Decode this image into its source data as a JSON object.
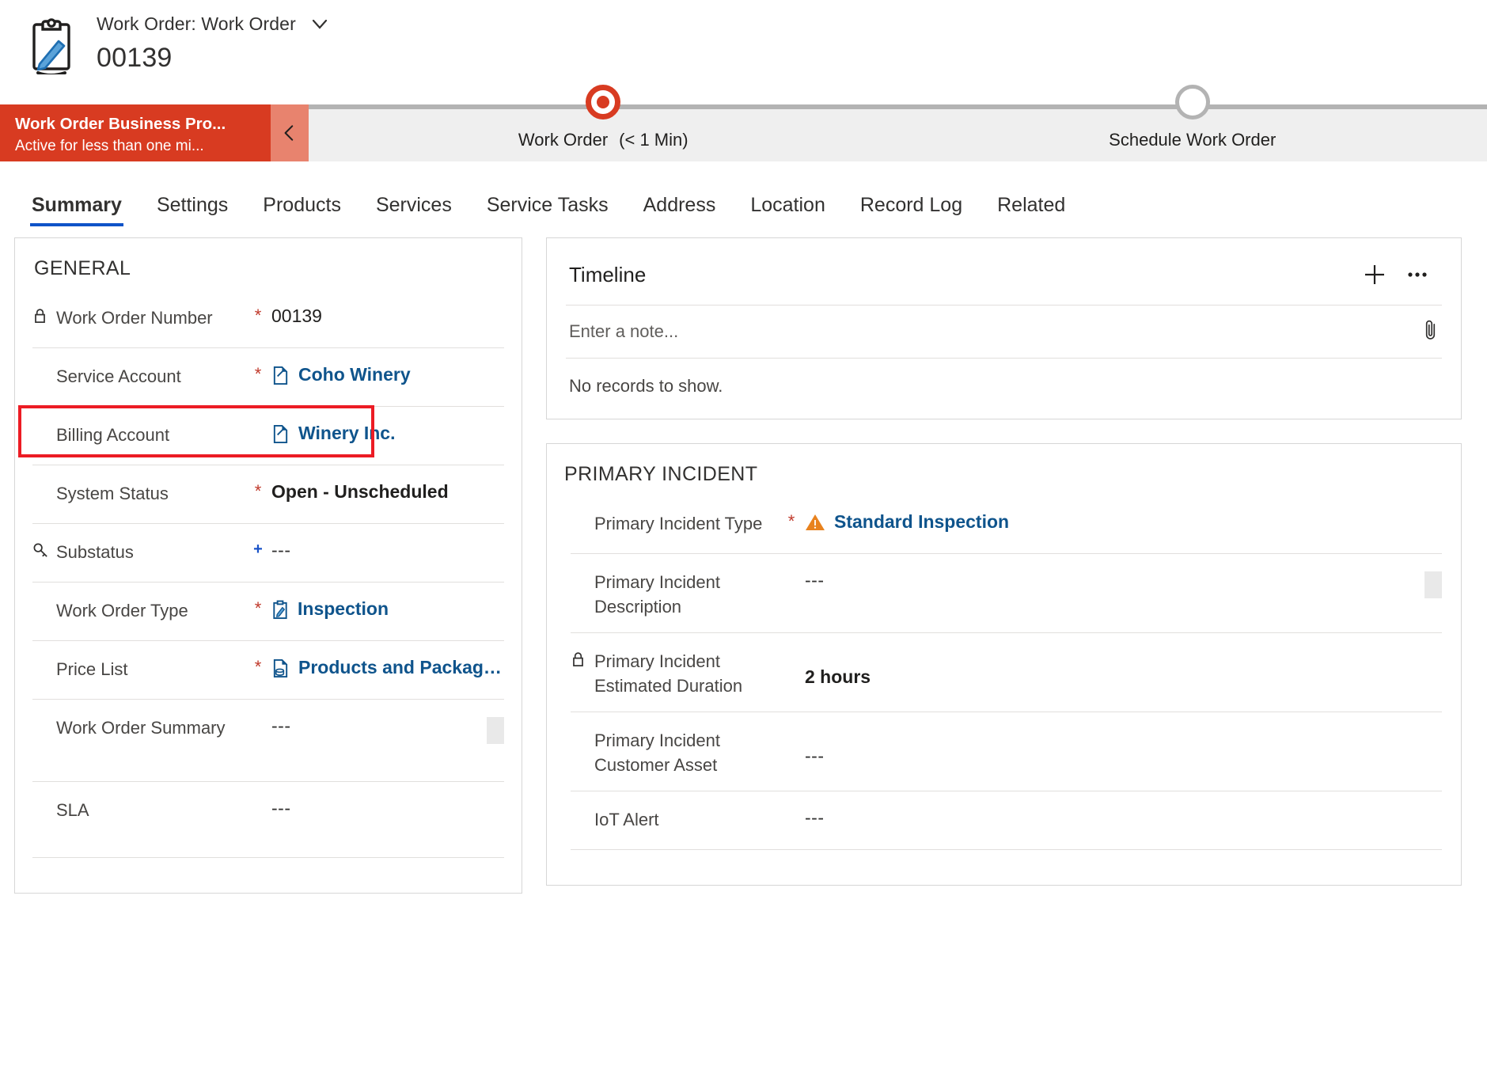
{
  "header": {
    "icon": "clipboard-pencil-icon",
    "entity_label": "Work Order: Work Order",
    "record_name": "00139",
    "dropdown_icon": "chevron-down-icon"
  },
  "business_process_flow": {
    "name": "Work Order Business Pro...",
    "status": "Active for less than one mi...",
    "collapse_icon": "chevron-left-icon",
    "stages": [
      {
        "label": "Work Order",
        "time": "(< 1 Min)",
        "state": "active"
      },
      {
        "label": "Schedule Work Order",
        "time": "",
        "state": "inactive"
      }
    ]
  },
  "tabs": [
    {
      "label": "Summary",
      "active": true
    },
    {
      "label": "Settings",
      "active": false
    },
    {
      "label": "Products",
      "active": false
    },
    {
      "label": "Services",
      "active": false
    },
    {
      "label": "Service Tasks",
      "active": false
    },
    {
      "label": "Address",
      "active": false
    },
    {
      "label": "Location",
      "active": false
    },
    {
      "label": "Record Log",
      "active": false
    },
    {
      "label": "Related",
      "active": false
    }
  ],
  "general": {
    "title": "GENERAL",
    "fields": [
      {
        "label": "Work Order Number",
        "required": "*",
        "value": "00139",
        "lock": true
      },
      {
        "label": "Service Account",
        "required": "*",
        "value": "Coho Winery",
        "icon": "account-lookup-icon"
      },
      {
        "label": "Billing Account",
        "required": "",
        "value": "Winery Inc.",
        "icon": "account-lookup-icon",
        "highlighted": true
      },
      {
        "label": "System Status",
        "required": "*",
        "value": "Open - Unscheduled"
      },
      {
        "label": "Substatus",
        "required": "+",
        "value": "---",
        "lock_icon": "key-icon"
      },
      {
        "label": "Work Order Type",
        "required": "*",
        "value": "Inspection",
        "icon": "work-order-type-icon"
      },
      {
        "label": "Price List",
        "required": "*",
        "value": "Products and Packaged Se...",
        "icon": "price-list-icon"
      },
      {
        "label": "Work Order Summary",
        "required": "",
        "value": "---",
        "resizable": true
      },
      {
        "label": "SLA",
        "required": "",
        "value": "---"
      }
    ]
  },
  "timeline": {
    "title": "Timeline",
    "add_icon": "plus-icon",
    "more_icon": "ellipsis-icon",
    "note_placeholder": "Enter a note...",
    "attach_icon": "paperclip-icon",
    "empty_text": "No records to show."
  },
  "primary_incident": {
    "title": "PRIMARY INCIDENT",
    "fields": [
      {
        "label": "Primary Incident Type",
        "required": "*",
        "value": "Standard Inspection",
        "icon": "warning-triangle-icon"
      },
      {
        "label": "Primary Incident Description",
        "required": "",
        "value": "---",
        "resizable": true
      },
      {
        "label": "Primary Incident Estimated Duration",
        "required": "",
        "value": "2 hours",
        "lock": true
      },
      {
        "label": "Primary Incident Customer Asset",
        "required": "",
        "value": "---"
      },
      {
        "label": "IoT Alert",
        "required": "",
        "value": "---"
      }
    ]
  },
  "colors": {
    "bpf_red": "#d83b21",
    "bpf_collapse": "#e8836e",
    "link_blue": "#0f548c",
    "tab_underline": "#0f53c8",
    "required_red": "#c0392b",
    "highlight_red": "#ec1c24",
    "warning_orange": "#e8821e"
  }
}
